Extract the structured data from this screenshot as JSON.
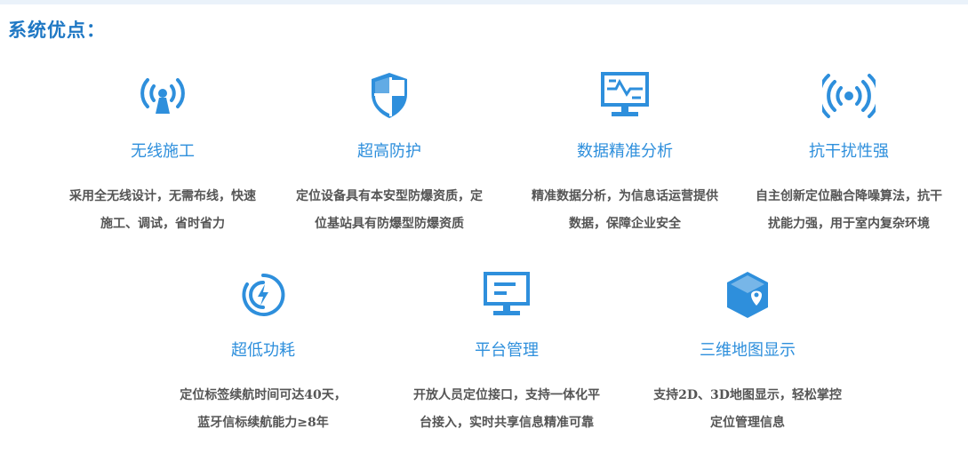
{
  "section": {
    "title": "系统优点："
  },
  "features_row1": [
    {
      "icon": "wireless-signal-icon",
      "title": "无线施工",
      "desc1": "采用全无线设计，无需布线，快速",
      "desc2": "施工、调试，省时省力"
    },
    {
      "icon": "shield-icon",
      "title": "超高防护",
      "desc1": "定位设备具有本安型防爆资质，定",
      "desc2": "位基站具有防爆型防爆资质"
    },
    {
      "icon": "data-analysis-monitor-icon",
      "title": "数据精准分析",
      "desc1": "精准数据分析，为信息话运营提供",
      "desc2": "数据，保障企业安全"
    },
    {
      "icon": "anti-interference-signal-icon",
      "title": "抗干扰性强",
      "desc1": "自主创新定位融合降噪算法，抗干",
      "desc2": "扰能力强，用于室内复杂环境"
    }
  ],
  "features_row2": [
    {
      "icon": "low-power-icon",
      "title": "超低功耗",
      "desc1": "定位标签续航时间可达40天，",
      "desc2": "蓝牙信标续航能力≥8年"
    },
    {
      "icon": "platform-monitor-icon",
      "title": "平台管理",
      "desc1": "开放人员定位接口，支持一体化平",
      "desc2": "台接入，实时共享信息精准可靠"
    },
    {
      "icon": "3d-map-cube-icon",
      "title": "三维地图显示",
      "desc1": "支持2D、3D地图显示，轻松掌控",
      "desc2": "定位管理信息"
    }
  ],
  "colors": {
    "accent": "#2e8fdc",
    "title": "#1f78c4",
    "text": "#555555"
  }
}
